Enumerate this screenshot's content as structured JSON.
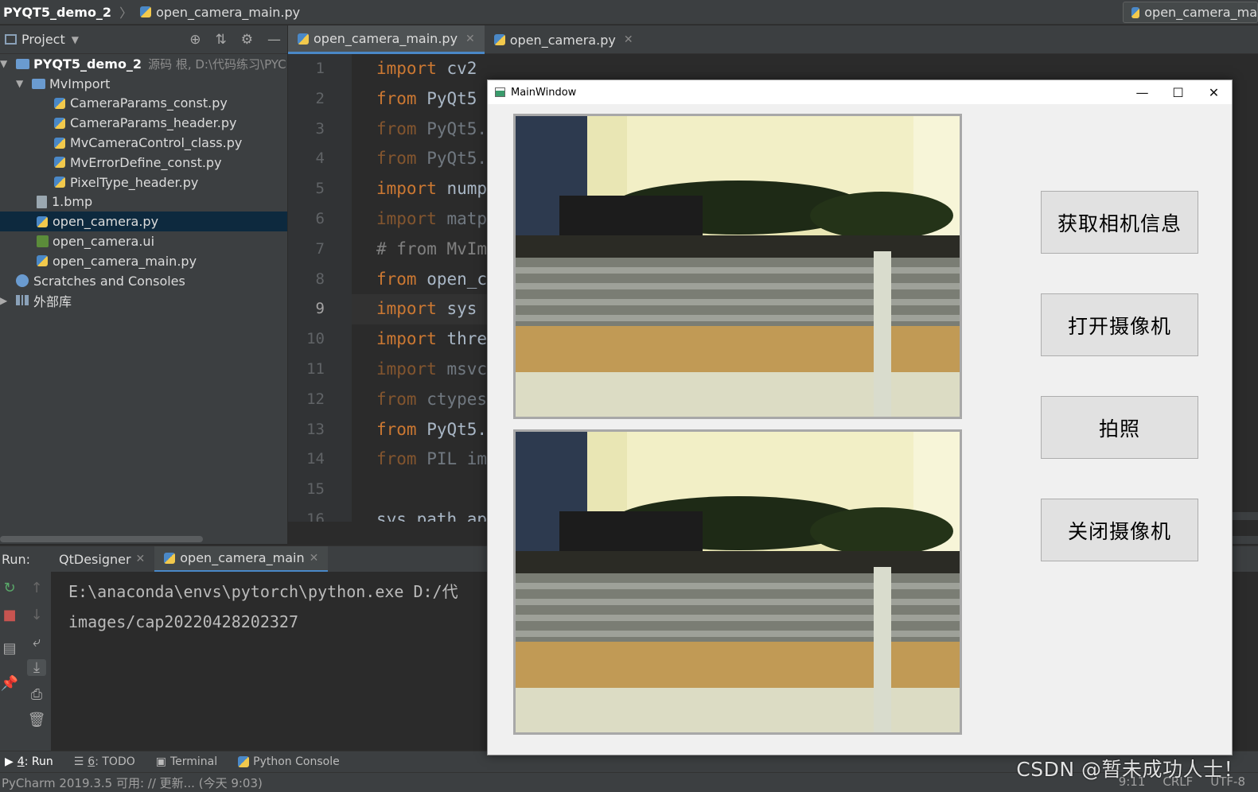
{
  "breadcrumb": {
    "project": "PYQT5_demo_2",
    "file": "open_camera_main.py"
  },
  "run_config": {
    "label": "open_camera_ma"
  },
  "project_panel": {
    "title": "Project",
    "root": {
      "name": "PYQT5_demo_2",
      "meta": "源码 根, D:\\代码练习\\PYC"
    },
    "folder": {
      "name": "MvImport"
    },
    "folder_files": [
      "CameraParams_const.py",
      "CameraParams_header.py",
      "MvCameraControl_class.py",
      "MvErrorDefine_const.py",
      "PixelType_header.py"
    ],
    "files": [
      "1.bmp",
      "open_camera.py",
      "open_camera.ui",
      "open_camera_main.py"
    ],
    "scratches": "Scratches and Consoles",
    "external": "外部库"
  },
  "editor_tabs": [
    {
      "label": "open_camera_main.py"
    },
    {
      "label": "open_camera.py"
    }
  ],
  "line_numbers": [
    "1",
    "2",
    "3",
    "4",
    "5",
    "6",
    "7",
    "8",
    "9",
    "10",
    "11",
    "12",
    "13",
    "14",
    "15",
    "16"
  ],
  "code_lines": [
    {
      "kw": "import",
      "rest": " cv2"
    },
    {
      "kw": "from",
      "rest": " PyQt5"
    },
    {
      "kw": "from",
      "rest": " PyQt5."
    },
    {
      "kw": "from",
      "rest": " PyQt5."
    },
    {
      "kw": "import",
      "rest": " nump"
    },
    {
      "kw": "import",
      "rest": " matp"
    },
    {
      "kw": "# from",
      "rest": " MvIm"
    },
    {
      "kw": "from",
      "rest": " open_c"
    },
    {
      "kw": "import",
      "rest": " sys"
    },
    {
      "kw": "import",
      "rest": " thre"
    },
    {
      "kw": "import",
      "rest": " msvc"
    },
    {
      "kw": "from",
      "rest": " ctypes"
    },
    {
      "kw": "from",
      "rest": " PyQt5."
    },
    {
      "kw": "from",
      "rest": " PIL im"
    },
    {
      "kw": "",
      "rest": ""
    },
    {
      "kw": "",
      "rest": "sys.path.ap"
    }
  ],
  "run_panel": {
    "label": "Run:",
    "tabs": [
      {
        "label": "QtDesigner"
      },
      {
        "label": "open_camera_main"
      }
    ],
    "output": [
      "E:\\anaconda\\envs\\pytorch\\python.exe D:/代",
      "images/cap20220428202327"
    ]
  },
  "bottom_tabs": [
    {
      "num": "4",
      "label": ": Run"
    },
    {
      "num": "6",
      "label": ": TODO"
    },
    {
      "num": "",
      "label": "Terminal"
    },
    {
      "num": "",
      "label": "Python Console"
    }
  ],
  "statusbar": {
    "message": "PyCharm 2019.3.5 可用: // 更新... (今天 9:03)",
    "pos": "9:11",
    "eol": "CRLF",
    "enc": "UTF-8"
  },
  "qt_window": {
    "title": "MainWindow",
    "buttons": [
      "获取相机信息",
      "打开摄像机",
      "拍照",
      "关闭摄像机"
    ]
  },
  "watermark": "CSDN @暂未成功人士！",
  "colors": {
    "keyword": "#cc7832",
    "accent": "#4a88c7",
    "selection": "#0d293e"
  }
}
